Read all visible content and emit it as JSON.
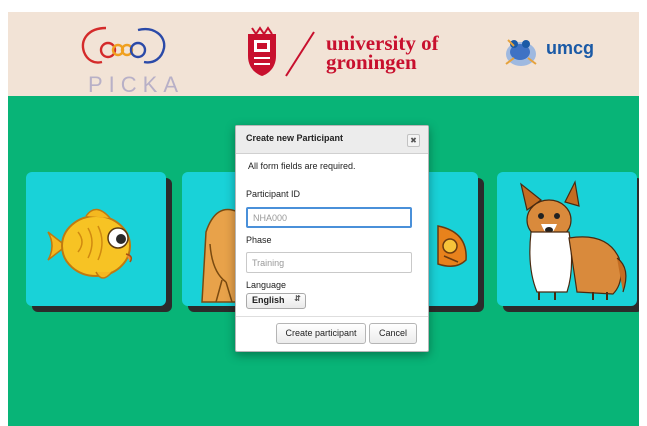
{
  "header": {
    "picka_logo_text": "PICKA",
    "university_line1": "university of",
    "university_line2": "groningen",
    "umcg_text": "umcg"
  },
  "cards": [
    {
      "subject": "fish"
    },
    {
      "subject": "girl"
    },
    {
      "subject": "cap"
    },
    {
      "subject": "dog"
    }
  ],
  "dialog": {
    "title": "Create new Participant",
    "close_icon": "close-icon",
    "notice": "All form fields are required.",
    "participant_id_label": "Participant ID",
    "participant_id_placeholder": "NHA000",
    "phase_label": "Phase",
    "phase_placeholder": "Training",
    "language_label": "Language",
    "language_selected": "English",
    "create_button": "Create participant",
    "cancel_button": "Cancel"
  },
  "colors": {
    "header_bg": "#f2e3d6",
    "main_bg": "#08b477",
    "card_bg": "#19d2d8",
    "rug_red": "#c8102e",
    "umcg_blue": "#1b5aa6"
  }
}
